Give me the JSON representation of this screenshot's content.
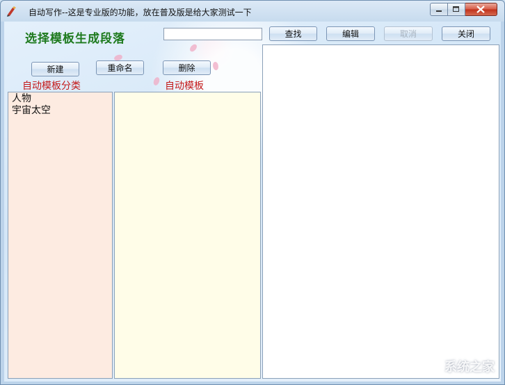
{
  "window": {
    "title": "自动写作--这是专业版的功能，放在普及版是给大家测试一下"
  },
  "header": {
    "heading": "选择模板生成段落",
    "search_value": "",
    "find_label": "查找",
    "edit_label": "编辑",
    "cancel_label": "取消",
    "close_label": "关闭"
  },
  "toolbar": {
    "new_label": "新建",
    "rename_label": "重命名",
    "delete_label": "删除"
  },
  "categories": {
    "title": "自动模板分类",
    "items": [
      "人物",
      "宇宙太空"
    ]
  },
  "templates": {
    "title": "自动模板",
    "items": []
  },
  "watermark": "系统之家",
  "colors": {
    "heading": "#1e7a1e",
    "section_label": "#c41a1a",
    "category_panel_bg": "#fdebe1",
    "template_panel_bg": "#fffde8"
  }
}
